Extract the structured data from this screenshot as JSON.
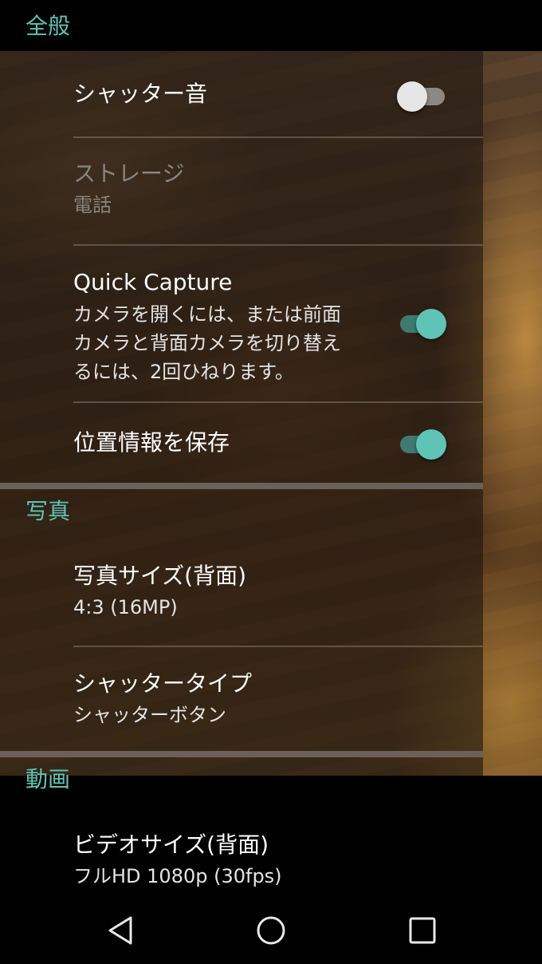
{
  "colors": {
    "accent": "#5ec4b6",
    "toggle_on_track": "#3e7a72",
    "toggle_off_thumb": "#e6e6e6"
  },
  "sections": {
    "general": {
      "title": "全般",
      "shutter_sound": {
        "title": "シャッター音",
        "enabled": false
      },
      "storage": {
        "title": "ストレージ",
        "value": "電話",
        "disabled": true
      },
      "quick_capture": {
        "title": "Quick Capture",
        "description_lines": [
          "カメラを開くには、または前面",
          "カメラと背面カメラを切り替え",
          "るには、2回ひねります。"
        ],
        "enabled": true
      },
      "save_location": {
        "title": "位置情報を保存",
        "enabled": true
      }
    },
    "photo": {
      "title": "写真",
      "photo_size": {
        "title": "写真サイズ(背面)",
        "value": "4:3 (16MP)"
      },
      "shutter_type": {
        "title": "シャッタータイプ",
        "value": "シャッターボタン"
      }
    },
    "video": {
      "title": "動画",
      "video_size": {
        "title": "ビデオサイズ(背面)",
        "value": "フルHD 1080p (30fps)"
      }
    }
  },
  "navbar": {
    "icons": [
      "back-icon",
      "home-icon",
      "recents-icon"
    ]
  }
}
